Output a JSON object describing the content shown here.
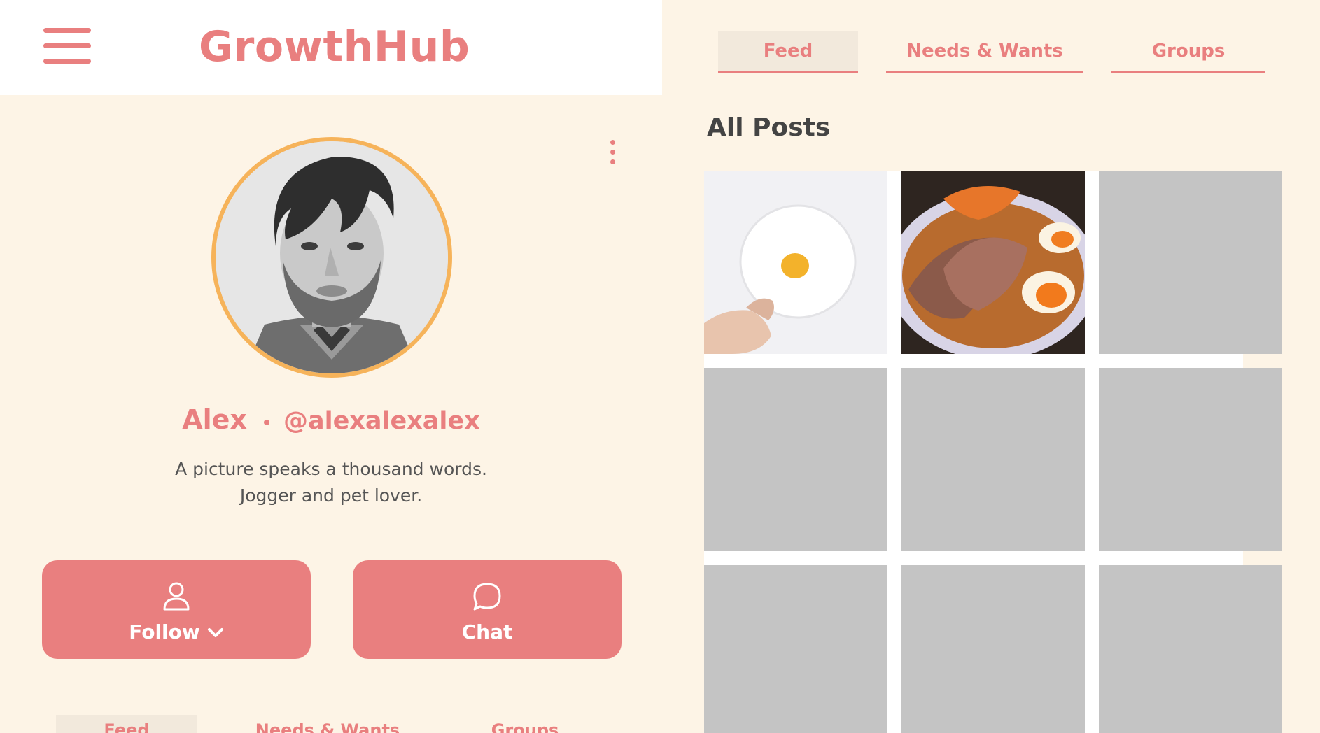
{
  "app": {
    "title": "GrowthHub"
  },
  "profile": {
    "name": "Alex",
    "handle": "@alexalexalex",
    "bio_line1": "A picture speaks a thousand words.",
    "bio_line2": "Jogger and pet lover.",
    "avatar_icon": "user-photo"
  },
  "actions": {
    "follow_label": "Follow",
    "chat_label": "Chat"
  },
  "tabs": [
    {
      "label": "Feed",
      "active": true
    },
    {
      "label": "Needs & Wants",
      "active": false
    },
    {
      "label": "Groups",
      "active": false
    }
  ],
  "posts": {
    "section_title": "All Posts",
    "items": [
      {
        "kind": "photo",
        "subject": "egg-plate"
      },
      {
        "kind": "photo",
        "subject": "ramen-bowl"
      },
      {
        "kind": "placeholder"
      },
      {
        "kind": "placeholder"
      },
      {
        "kind": "placeholder"
      },
      {
        "kind": "placeholder"
      },
      {
        "kind": "placeholder"
      },
      {
        "kind": "placeholder"
      },
      {
        "kind": "placeholder"
      }
    ]
  },
  "colors": {
    "accent": "#e97f7f",
    "avatar_ring": "#f6b35a",
    "background": "#fdf4e6",
    "tab_active_bg": "#f2e9dc",
    "placeholder": "#c4c4c4"
  }
}
